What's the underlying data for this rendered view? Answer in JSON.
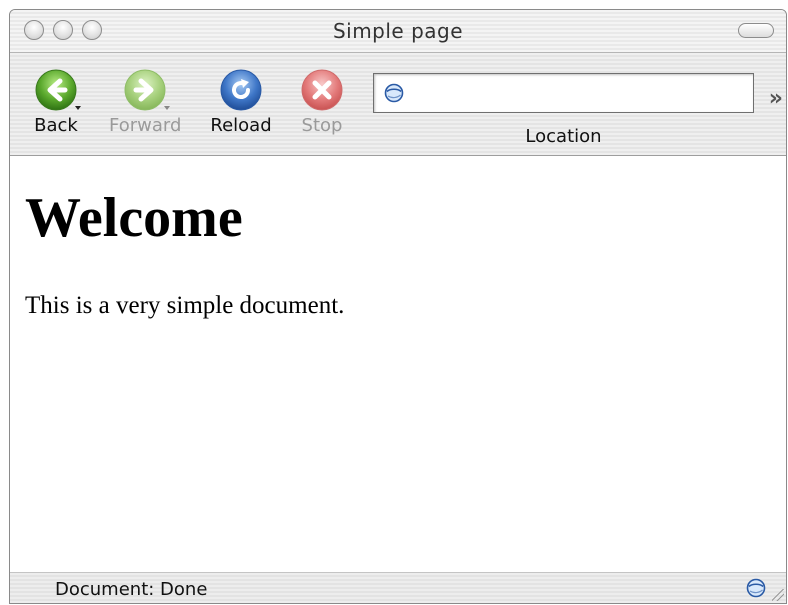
{
  "window": {
    "title": "Simple page"
  },
  "toolbar": {
    "back_label": "Back",
    "forward_label": "Forward",
    "reload_label": "Reload",
    "stop_label": "Stop",
    "location_label": "Location",
    "location_value": "",
    "overflow_glyph": "»",
    "back_enabled": true,
    "forward_enabled": false,
    "reload_enabled": true,
    "stop_enabled": false,
    "icons": {
      "back": "arrow-left-icon",
      "forward": "arrow-right-icon",
      "reload": "reload-icon",
      "stop": "stop-x-icon",
      "location": "globe-icon"
    }
  },
  "content": {
    "heading": "Welcome",
    "paragraph": "This is a very simple document."
  },
  "status": {
    "text": "Document: Done"
  },
  "colors": {
    "back": "#5aa82c",
    "forward": "#a6d07c",
    "reload": "#3f77c8",
    "stop": "#e37a7a"
  }
}
